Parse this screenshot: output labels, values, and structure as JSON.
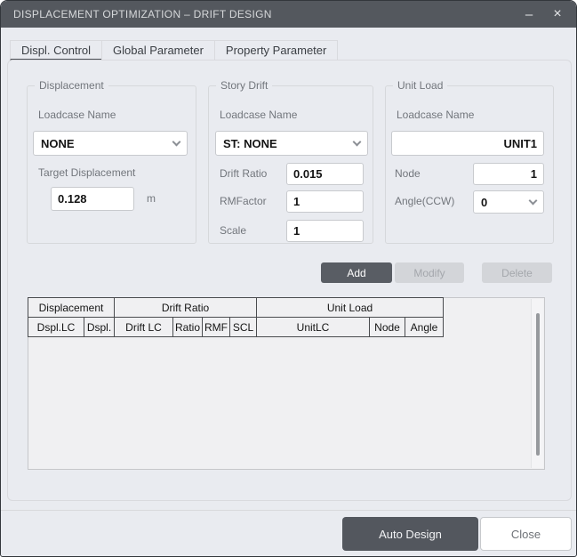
{
  "window": {
    "title": "DISPLACEMENT OPTIMIZATION – DRIFT DESIGN",
    "minimize_glyph": "–",
    "close_glyph": "×"
  },
  "tabs": {
    "displ_control": "Displ. Control",
    "global_parameter": "Global Parameter",
    "property_parameter": "Property Parameter"
  },
  "displacement": {
    "title": "Displacement",
    "loadcase_label": "Loadcase Name",
    "loadcase_value": "NONE",
    "target_label": "Target Displacement",
    "target_value": "0.128",
    "target_unit": "m"
  },
  "story_drift": {
    "title": "Story Drift",
    "loadcase_label": "Loadcase Name",
    "loadcase_value": "ST: NONE",
    "drift_ratio_label": "Drift Ratio",
    "drift_ratio_value": "0.015",
    "rmfactor_label": "RMFactor",
    "rmfactor_value": "1",
    "scale_label": "Scale",
    "scale_value": "1"
  },
  "unit_load": {
    "title": "Unit Load",
    "loadcase_label": "Loadcase Name",
    "loadcase_value": "UNIT1",
    "node_label": "Node",
    "node_value": "1",
    "angle_label": "Angle(CCW)",
    "angle_value": "0"
  },
  "actions": {
    "add": "Add",
    "modify": "Modify",
    "delete": "Delete"
  },
  "table": {
    "groups": [
      "Displacement",
      "Drift Ratio",
      "Unit Load"
    ],
    "columns": [
      "Dspl.LC",
      "Dspl.",
      "Drift LC",
      "Ratio",
      "RMF",
      "SCL",
      "UnitLC",
      "Node",
      "Angle"
    ],
    "rows": []
  },
  "footer": {
    "auto_design": "Auto Design",
    "close": "Close"
  },
  "colors": {
    "titlebar_bg": "#54585e",
    "dialog_bg": "#e9ebf0",
    "primary_button_bg": "#595d64",
    "disabled_button_bg": "#d3d5d9",
    "disabled_button_text": "#a4a7ac",
    "table_border": "#4a4c4f"
  }
}
